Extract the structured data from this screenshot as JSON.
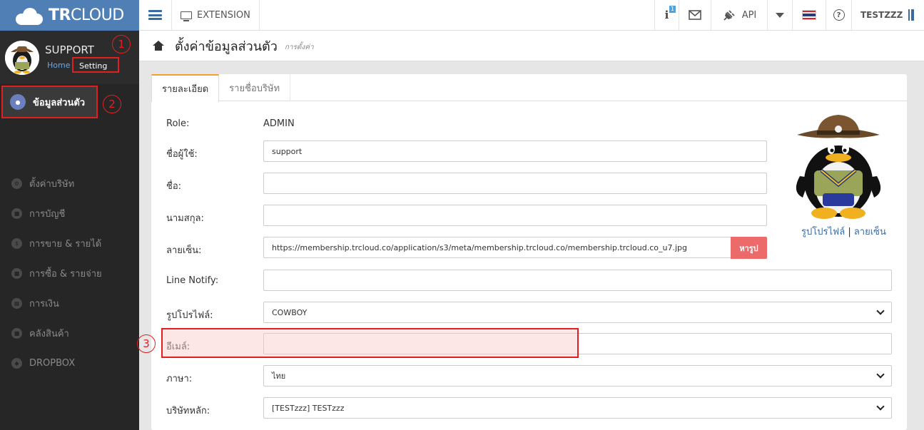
{
  "app": {
    "brand_bold": "TR",
    "brand_rest": "CLOUD"
  },
  "topbar": {
    "extension": "EXTENSION",
    "info_badge": "1",
    "api": "API",
    "user": "TESTZZZ"
  },
  "sidebar": {
    "profile_name": "SUPPORT",
    "home_link": "Home",
    "setting_link": "Setting",
    "items": [
      {
        "label": "ข้อมูลส่วนตัว",
        "icon": "user-icon"
      },
      {
        "label": "ตั้งค่าบริษัท",
        "icon": "gear-icon"
      },
      {
        "label": "การบัญชี",
        "icon": "book-icon"
      },
      {
        "label": "การขาย & รายได้",
        "icon": "dollar-icon"
      },
      {
        "label": "การซื้อ & รายจ่าย",
        "icon": "cart-icon"
      },
      {
        "label": "การเงิน",
        "icon": "calendar-icon"
      },
      {
        "label": "คลังสินค้า",
        "icon": "truck-icon"
      },
      {
        "label": "DROPBOX",
        "icon": "dropbox-icon"
      }
    ]
  },
  "annotations": {
    "n1": "1",
    "n2": "2",
    "n3": "3"
  },
  "header": {
    "title": "ตั้งค่าข้อมูลส่วนตัว",
    "subtitle": "การตั้งค่า"
  },
  "tabs": [
    {
      "label": "รายละเอียด"
    },
    {
      "label": "รายชื่อบริษัท"
    }
  ],
  "form": {
    "role_label": "Role:",
    "role_value": "ADMIN",
    "username_label": "ชื่อผู้ใช้:",
    "username_value": "support",
    "firstname_label": "ชื่อ:",
    "firstname_value": "",
    "lastname_label": "นามสกุล:",
    "lastname_value": "",
    "signature_label": "ลายเซ็น:",
    "signature_value": "https://membership.trcloud.co/application/s3/meta/membership.trcloud.co/membership.trcloud.co_u7.jpg",
    "signature_button": "หารูป",
    "line_label": "Line Notify:",
    "line_value": "",
    "profile_pic_label": "รูปโปรไฟล์:",
    "profile_pic_value": "COWBOY",
    "email_label": "อีเมล์:",
    "email_value": "",
    "language_label": "ภาษา:",
    "language_value": "ไทย",
    "company_label": "บริษัทหลัก:",
    "company_value": "[TESTzzz] TESTzzz"
  },
  "picture": {
    "profile_link": "รูปโปรไฟล์",
    "separator": "|",
    "signature_link": "ลายเซ็น"
  }
}
